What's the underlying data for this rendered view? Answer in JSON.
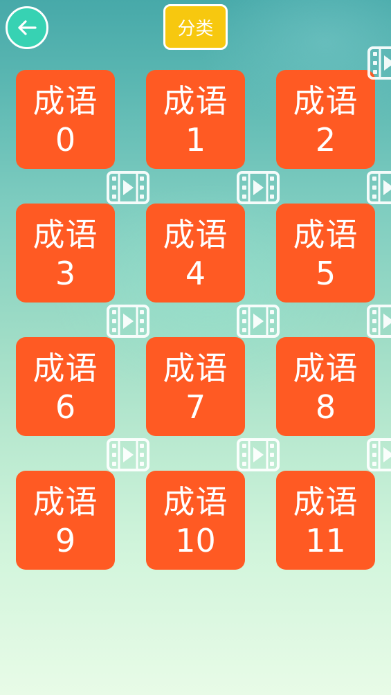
{
  "header": {
    "back_icon": "arrow-left-icon",
    "category_label": "分类"
  },
  "levels": [
    {
      "title": "成语",
      "number": "0"
    },
    {
      "title": "成语",
      "number": "1"
    },
    {
      "title": "成语",
      "number": "2"
    },
    {
      "title": "成语",
      "number": "3"
    },
    {
      "title": "成语",
      "number": "4"
    },
    {
      "title": "成语",
      "number": "5"
    },
    {
      "title": "成语",
      "number": "6"
    },
    {
      "title": "成语",
      "number": "7"
    },
    {
      "title": "成语",
      "number": "8"
    },
    {
      "title": "成语",
      "number": "9"
    },
    {
      "title": "成语",
      "number": "10"
    },
    {
      "title": "成语",
      "number": "11"
    }
  ],
  "video_badge_icon": "video-play-icon",
  "colors": {
    "tile": "#ff5a23",
    "back_button": "#37d2b3",
    "category_button": "#f7c80f",
    "text": "#ffffff"
  }
}
